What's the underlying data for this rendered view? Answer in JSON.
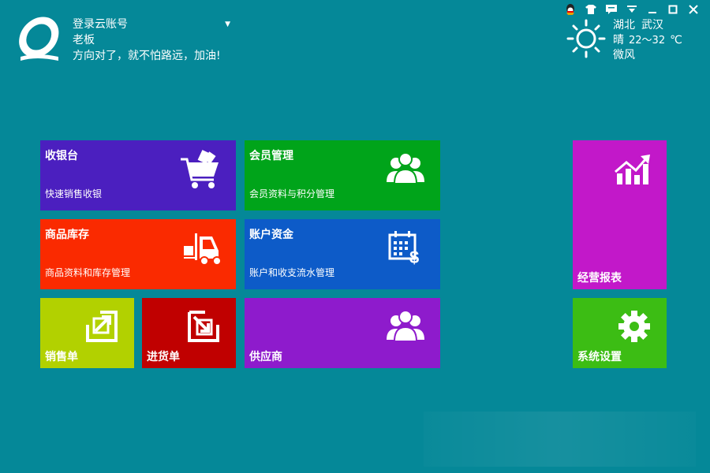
{
  "header": {
    "login_label": "登录云账号",
    "user_name": "老板",
    "slogan": "方向对了，就不怕路远，加油!"
  },
  "window_controls": [
    "qq-icon",
    "skin-icon",
    "message-icon",
    "menu-icon",
    "minimize-icon",
    "maximize-icon",
    "close-icon"
  ],
  "weather": {
    "province": "湖北",
    "city": "武汉",
    "condition": "晴",
    "temp_range": "22～32",
    "unit": "℃",
    "wind": "微风",
    "icon": "sun-icon"
  },
  "tiles": {
    "cashier": {
      "title": "收银台",
      "subtitle": "快速销售收银",
      "icon": "shopping-cart-icon",
      "color": "#4b1fbf"
    },
    "members": {
      "title": "会员管理",
      "subtitle": "会员资料与积分管理",
      "icon": "users-icon",
      "color": "#00a41a"
    },
    "inventory": {
      "title": "商品库存",
      "subtitle": "商品资料和库存管理",
      "icon": "forklift-icon",
      "color": "#fa2a00"
    },
    "accounts": {
      "title": "账户资金",
      "subtitle": "账户和收支流水管理",
      "icon": "calendar-money-icon",
      "color": "#0d5bc8"
    },
    "sales_order": {
      "title": "销售单",
      "icon": "export-icon",
      "color": "#b2d100"
    },
    "purchase_order": {
      "title": "进货单",
      "icon": "import-icon",
      "color": "#c00000"
    },
    "supplier": {
      "title": "供应商",
      "icon": "users-icon",
      "color": "#8e1bcc"
    },
    "reports": {
      "title": "经营报表",
      "icon": "chart-icon",
      "color": "#c218c9"
    },
    "settings": {
      "title": "系统设置",
      "icon": "gear-icon",
      "color": "#3cbd14"
    }
  }
}
